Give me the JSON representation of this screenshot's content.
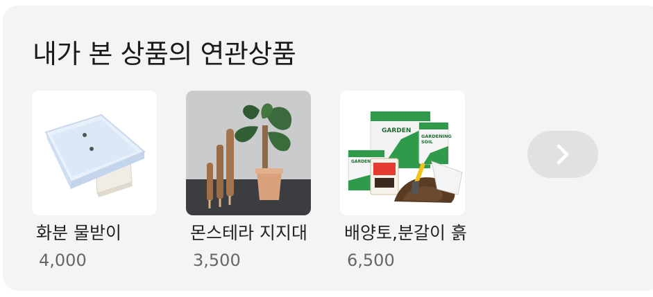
{
  "section": {
    "title": "내가 본 상품의 연관상품"
  },
  "products": [
    {
      "name": "화분 물받이",
      "price": "4,000",
      "image_icon": "white-square-plant-saucer"
    },
    {
      "name": "몬스테라 지지대",
      "price": "3,500",
      "image_icon": "monstera-coir-poles"
    },
    {
      "name": "배양토,분갈이 흙",
      "price": "6,500",
      "image_icon": "gardening-soil-bags"
    }
  ],
  "navigation": {
    "next_icon": "chevron-right-icon"
  }
}
